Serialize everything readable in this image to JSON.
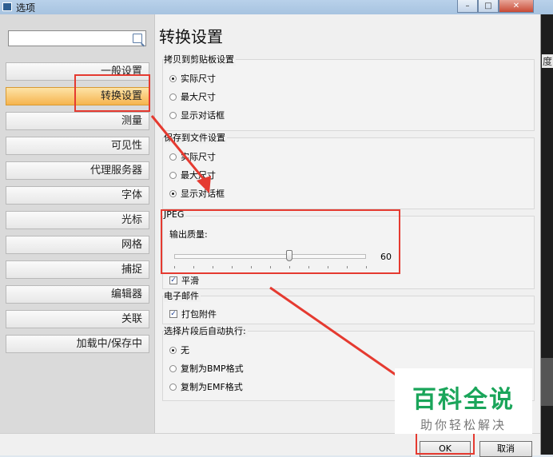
{
  "window": {
    "title": "选项",
    "minimize": "–",
    "maximize": "□",
    "close": "✕"
  },
  "side_text": "度",
  "nav": {
    "items": [
      {
        "label": "一般设置"
      },
      {
        "label": "转换设置"
      },
      {
        "label": "测量"
      },
      {
        "label": "可见性"
      },
      {
        "label": "代理服务器"
      },
      {
        "label": "字体"
      },
      {
        "label": "光标"
      },
      {
        "label": "网格"
      },
      {
        "label": "捕捉"
      },
      {
        "label": "编辑器"
      },
      {
        "label": "关联"
      },
      {
        "label": "加载中/保存中"
      }
    ],
    "active_index": 1
  },
  "heading": "转换设置",
  "clipboard": {
    "label": "拷贝到剪贴板设置",
    "options": [
      "实际尺寸",
      "最大尺寸",
      "显示对话框"
    ],
    "selected": 0
  },
  "savefile": {
    "label": "保存到文件设置",
    "options": [
      "实际尺寸",
      "最大尺寸",
      "显示对话框"
    ],
    "selected": 2
  },
  "jpeg": {
    "label": "JPEG",
    "quality_label": "输出质量:",
    "value": "60",
    "min": 0,
    "max": 100,
    "smooth_label": "平滑",
    "smooth_checked": "✓"
  },
  "email": {
    "label": "电子邮件",
    "attach_label": "打包附件",
    "attach_checked": "✓"
  },
  "autoexec": {
    "label": "选择片段后自动执行:",
    "options": [
      "无",
      "复制为BMP格式",
      "复制为EMF格式"
    ],
    "selected": 0
  },
  "buttons": {
    "ok": "OK",
    "cancel": "取消"
  },
  "watermark": {
    "main": "百科全说",
    "sub": "助你轻松解决"
  },
  "colors": {
    "annotation_red": "#e53a30",
    "active_nav": "#f6b44e",
    "watermark_green": "#1aa55a"
  }
}
